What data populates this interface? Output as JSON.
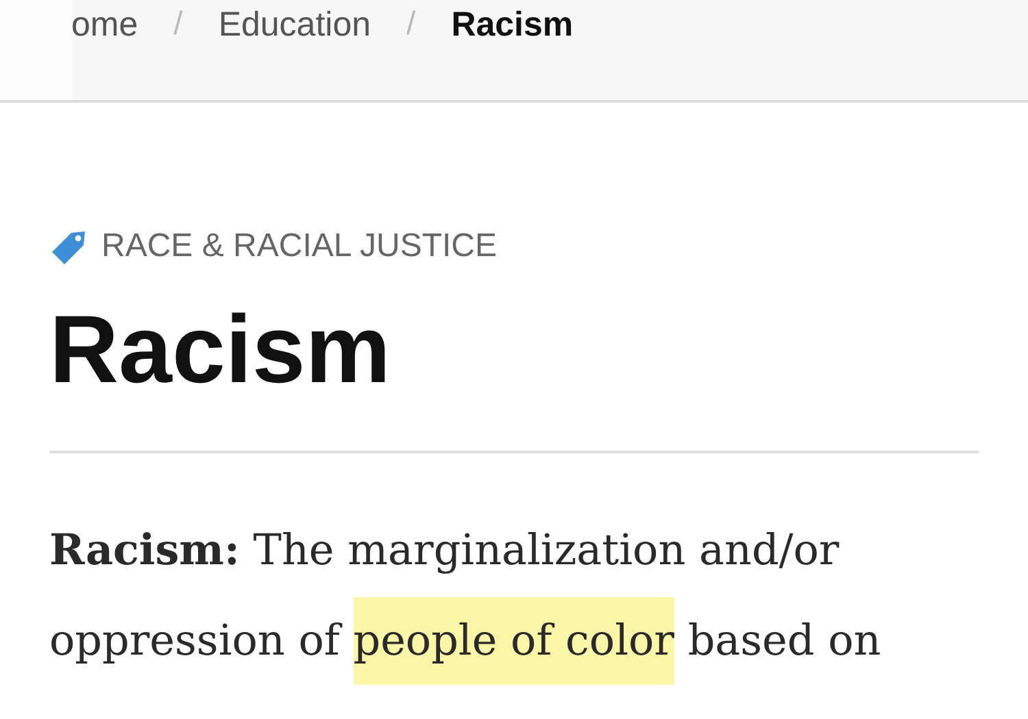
{
  "breadcrumb": [
    {
      "label": "ome",
      "current": false
    },
    {
      "label": "Education",
      "current": false
    },
    {
      "label": "Racism",
      "current": true
    }
  ],
  "separator": "/",
  "category": "RACE & RACIAL JUSTICE",
  "title": "Racism",
  "paragraph": [
    {
      "text": "**Racism:** The marginalization and/or oppression of ",
      "highlighted": false
    },
    {
      "text": "people of color",
      "highlighted": true
    },
    {
      "text": " based on",
      "highlighted": false
    }
  ]
}
